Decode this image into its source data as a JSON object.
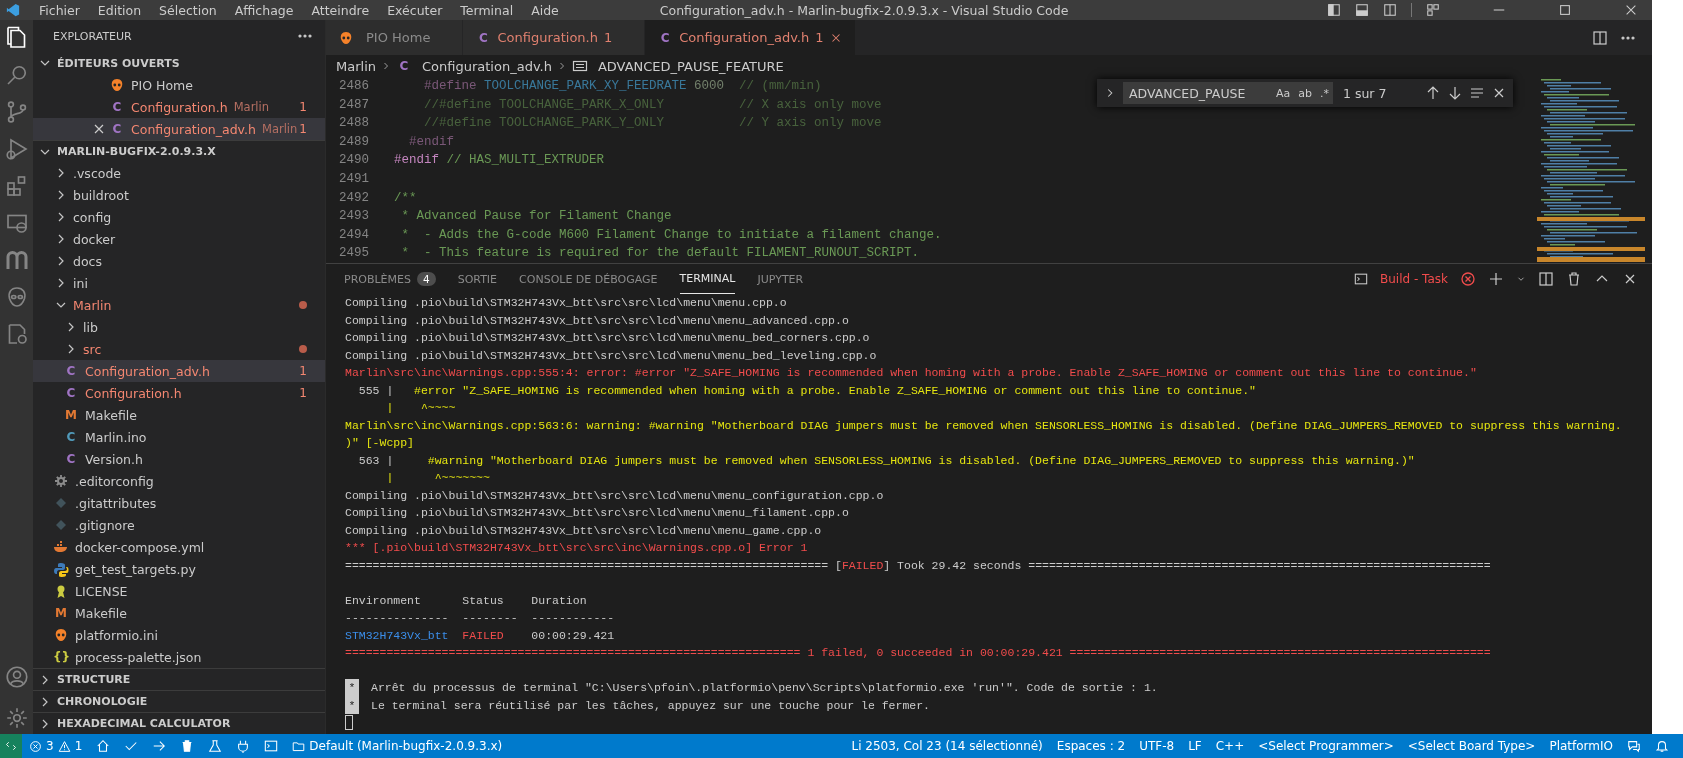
{
  "title_bar": {
    "menu": [
      "Fichier",
      "Edition",
      "Sélection",
      "Affichage",
      "Atteindre",
      "Exécuter",
      "Terminal",
      "Aide"
    ],
    "title": "Configuration_adv.h - Marlin-bugfix-2.0.9.3.x - Visual Studio Code"
  },
  "activity_bar": {
    "items": [
      {
        "kind": "files",
        "selected": true
      },
      {
        "kind": "search",
        "selected": false
      },
      {
        "kind": "source-control",
        "selected": false
      },
      {
        "kind": "run",
        "selected": false
      },
      {
        "kind": "extensions",
        "selected": false
      },
      {
        "kind": "remote",
        "selected": false
      },
      {
        "kind": "arches",
        "selected": false
      },
      {
        "kind": "alien",
        "selected": false
      },
      {
        "kind": "doc-gear",
        "selected": false
      }
    ]
  },
  "sidebar": {
    "title": "EXPLORATEUR",
    "open_editors": {
      "label": "ÉDITEURS OUVERTS",
      "expanded": true,
      "items": [
        {
          "kind": "piofile",
          "name": "PIO Home",
          "error": false,
          "selected": false
        },
        {
          "kind": "cfile",
          "name": "Configuration.h",
          "glyph": "C",
          "folder": "Marlin",
          "count": "1",
          "error": true,
          "selected": false
        },
        {
          "kind": "cfile",
          "name": "Configuration_adv.h",
          "glyph": "C",
          "folder": "Marlin",
          "count": "1",
          "error": true,
          "selected": true
        }
      ]
    },
    "project": {
      "label": "MARLIN-BUGFIX-2.0.9.3.X",
      "expanded": true,
      "children": [
        {
          "kind": "folder",
          "name": ".vscode",
          "expanded": false,
          "error": false,
          "modified": false,
          "selected": false
        },
        {
          "kind": "folder",
          "name": "buildroot",
          "expanded": false,
          "error": false,
          "modified": false,
          "selected": false
        },
        {
          "kind": "folder",
          "name": "config",
          "expanded": false,
          "error": false,
          "modified": false,
          "selected": false
        },
        {
          "kind": "folder",
          "name": "docker",
          "expanded": false,
          "error": false,
          "modified": false,
          "selected": false
        },
        {
          "kind": "folder",
          "name": "docs",
          "expanded": false,
          "error": false,
          "modified": false,
          "selected": false
        },
        {
          "kind": "folder",
          "name": "ini",
          "expanded": false,
          "error": false,
          "modified": false,
          "selected": false
        },
        {
          "kind": "folder",
          "name": "Marlin",
          "expanded": true,
          "error": true,
          "modified": true,
          "selected": false,
          "children": [
            {
              "kind": "folder",
              "name": "lib",
              "expanded": false,
              "error": false,
              "modified": false,
              "selected": false
            },
            {
              "kind": "folder",
              "name": "src",
              "expanded": false,
              "error": true,
              "modified": true,
              "selected": false
            },
            {
              "kind": "cfile",
              "name": "Configuration_adv.h",
              "glyph": "C",
              "count": "1",
              "error": true,
              "selected": true
            },
            {
              "kind": "cfile",
              "name": "Configuration.h",
              "glyph": "C",
              "count": "1",
              "error": true,
              "selected": false
            },
            {
              "kind": "makefile",
              "name": "Makefile",
              "glyph": "M",
              "error": false,
              "selected": false
            },
            {
              "kind": "inofile",
              "name": "Marlin.ino",
              "glyph": "C",
              "error": false,
              "selected": false
            },
            {
              "kind": "cfile",
              "name": "Version.h",
              "glyph": "C",
              "error": false,
              "selected": false
            }
          ]
        },
        {
          "kind": "gearfile",
          "name": ".editorconfig",
          "error": false,
          "selected": false
        },
        {
          "kind": "gitfile",
          "name": ".gitattributes",
          "error": false,
          "selected": false
        },
        {
          "kind": "gitfile",
          "name": ".gitignore",
          "error": false,
          "selected": false
        },
        {
          "kind": "dockerfile",
          "name": "docker-compose.yml",
          "error": false,
          "selected": false
        },
        {
          "kind": "pythonfile",
          "name": "get_test_targets.py",
          "error": false,
          "selected": false
        },
        {
          "kind": "licensefile",
          "name": "LICENSE",
          "error": false,
          "selected": false
        },
        {
          "kind": "makefile",
          "name": "Makefile",
          "glyph": "M",
          "error": false,
          "selected": false
        },
        {
          "kind": "piofile",
          "name": "platformio.ini",
          "error": false,
          "selected": false
        },
        {
          "kind": "jsonfile",
          "name": "process-palette.json",
          "glyph": "{}",
          "error": false,
          "selected": false
        }
      ]
    },
    "sections": [
      {
        "label": "STRUCTURE",
        "expanded": false
      },
      {
        "label": "CHRONOLOGIE",
        "expanded": false
      },
      {
        "label": "HEXADECIMAL CALCULATOR",
        "expanded": false
      }
    ]
  },
  "tabs": [
    {
      "kind": "piofile",
      "label": "PIO Home",
      "error": false,
      "selected": false
    },
    {
      "kind": "cfile",
      "label": "Configuration.h",
      "glyph": "C",
      "count": "1",
      "error": true,
      "selected": false
    },
    {
      "kind": "cfile",
      "label": "Configuration_adv.h",
      "glyph": "C",
      "count": "1",
      "error": true,
      "selected": true
    }
  ],
  "breadcrumb": [
    {
      "kind": "folder",
      "label": "Marlin"
    },
    {
      "kind": "cfile",
      "label": "Configuration_adv.h",
      "glyph": "C"
    },
    {
      "kind": "symbol",
      "label": "ADVANCED_PAUSE_FEATURE"
    }
  ],
  "editor": {
    "lines": [
      {
        "number": "2486",
        "inactive": true,
        "parts": [
          {
            "text": "    #define",
            "kind": "directive"
          },
          {
            "text": " TOOLCHANGE_PARK_XY_FEEDRATE ",
            "kind": "macro"
          },
          {
            "text": "6000",
            "kind": "number"
          },
          {
            "text": "  // (mm/min)",
            "kind": "comment"
          }
        ]
      },
      {
        "number": "2487",
        "inactive": true,
        "parts": [
          {
            "text": "    //#define TOOLCHANGE_PARK_X_ONLY          // X axis only move",
            "kind": "comment"
          }
        ]
      },
      {
        "number": "2488",
        "inactive": true,
        "parts": [
          {
            "text": "    //#define TOOLCHANGE_PARK_Y_ONLY          // Y axis only move",
            "kind": "comment"
          }
        ]
      },
      {
        "number": "2489",
        "inactive": true,
        "parts": [
          {
            "text": "  #endif",
            "kind": "directive"
          }
        ]
      },
      {
        "number": "2490",
        "inactive": false,
        "parts": [
          {
            "text": "#endif",
            "kind": "directive"
          },
          {
            "text": " // HAS_MULTI_EXTRUDER",
            "kind": "comment"
          }
        ]
      },
      {
        "number": "2491"
      },
      {
        "number": "2492",
        "inactive": false,
        "parts": [
          {
            "text": "/**",
            "kind": "comment"
          }
        ]
      },
      {
        "number": "2493",
        "inactive": false,
        "parts": [
          {
            "text": " * Advanced Pause for Filament Change",
            "kind": "comment"
          }
        ]
      },
      {
        "number": "2494",
        "inactive": false,
        "parts": [
          {
            "text": " *  - Adds the G-code M600 Filament Change to initiate a filament change.",
            "kind": "comment"
          }
        ]
      },
      {
        "number": "2495",
        "inactive": false,
        "parts": [
          {
            "text": " *  - This feature is required for the default FILAMENT_RUNOUT_SCRIPT.",
            "kind": "comment"
          }
        ]
      }
    ]
  },
  "find_widget": {
    "value": "ADVANCED_PAUSE",
    "options": [
      "Aa",
      "ab",
      ".*"
    ],
    "result": "1 sur 7"
  },
  "panel": {
    "tabs": [
      {
        "label": "PROBLÈMES",
        "badge": "4",
        "selected": false
      },
      {
        "label": "SORTIE",
        "selected": false
      },
      {
        "label": "CONSOLE DE DÉBOGAGE",
        "selected": false
      },
      {
        "label": "TERMINAL",
        "selected": true
      },
      {
        "label": "JUPYTER",
        "selected": false
      }
    ],
    "task": "Build - Task"
  },
  "terminal": {
    "cursor": true,
    "lines": [
      {
        "kind": "text",
        "parts": [
          {
            "text": "Compiling .pio\\build\\STM32H743Vx_btt\\src\\src\\lcd\\menu\\menu.cpp.o",
            "kind": "plain"
          }
        ]
      },
      {
        "kind": "text",
        "parts": [
          {
            "text": "Compiling .pio\\build\\STM32H743Vx_btt\\src\\src\\lcd\\menu\\menu_advanced.cpp.o",
            "kind": "plain"
          }
        ]
      },
      {
        "kind": "text",
        "parts": [
          {
            "text": "Compiling .pio\\build\\STM32H743Vx_btt\\src\\src\\lcd\\menu\\menu_bed_corners.cpp.o",
            "kind": "plain"
          }
        ]
      },
      {
        "kind": "text",
        "parts": [
          {
            "text": "Compiling .pio\\build\\STM32H743Vx_btt\\src\\src\\lcd\\menu\\menu_bed_leveling.cpp.o",
            "kind": "plain"
          }
        ]
      },
      {
        "kind": "text",
        "parts": [
          {
            "text": "Marlin\\src\\inc\\Warnings.cpp:555:4: error: #error \"Z_SAFE_HOMING is recommended when homing with a probe. Enable Z_SAFE_HOMING or comment out this line to continue.\"",
            "kind": "error"
          }
        ]
      },
      {
        "kind": "text",
        "parts": [
          {
            "text": "  555 |",
            "kind": "plain"
          },
          {
            "text": "   #error \"Z_SAFE_HOMING is recommended when homing with a probe. Enable Z_SAFE_HOMING or comment out this line to continue.\"",
            "kind": "warning"
          }
        ]
      },
      {
        "kind": "text",
        "parts": [
          {
            "text": "      |    ^~~~~",
            "kind": "warning"
          }
        ]
      },
      {
        "kind": "text",
        "parts": [
          {
            "text": "Marlin\\src\\inc\\Warnings.cpp:563:6: warning: #warning \"Motherboard DIAG jumpers must be removed when SENSORLESS_HOMING is disabled. (Define DIAG_JUMPERS_REMOVED to suppress this warning.",
            "kind": "warning"
          }
        ]
      },
      {
        "kind": "text",
        "parts": [
          {
            "text": ")\" [-Wcpp]",
            "kind": "warning"
          }
        ]
      },
      {
        "kind": "text",
        "parts": [
          {
            "text": "  563 |",
            "kind": "plain"
          },
          {
            "text": "     #warning \"Motherboard DIAG jumpers must be removed when SENSORLESS_HOMING is disabled. (Define DIAG_JUMPERS_REMOVED to suppress this warning.)\"",
            "kind": "warning"
          }
        ]
      },
      {
        "kind": "text",
        "parts": [
          {
            "text": "      |      ^~~~~~~~",
            "kind": "warning"
          }
        ]
      },
      {
        "kind": "text",
        "parts": [
          {
            "text": "Compiling .pio\\build\\STM32H743Vx_btt\\src\\src\\lcd\\menu\\menu_configuration.cpp.o",
            "kind": "plain"
          }
        ]
      },
      {
        "kind": "text",
        "parts": [
          {
            "text": "Compiling .pio\\build\\STM32H743Vx_btt\\src\\src\\lcd\\menu\\menu_filament.cpp.o",
            "kind": "plain"
          }
        ]
      },
      {
        "kind": "text",
        "parts": [
          {
            "text": "Compiling .pio\\build\\STM32H743Vx_btt\\src\\src\\lcd\\menu\\menu_game.cpp.o",
            "kind": "plain"
          }
        ]
      },
      {
        "kind": "text",
        "parts": [
          {
            "text": "*** [.pio\\build\\STM32H743Vx_btt\\src\\src\\inc\\Warnings.cpp.o] Error 1",
            "kind": "error"
          }
        ]
      },
      {
        "kind": "text",
        "parts": [
          {
            "text": "====================================================================== [",
            "kind": "plain"
          },
          {
            "text": "FAILED",
            "kind": "error"
          },
          {
            "text": "] Took 29.42 seconds ===================================================================",
            "kind": "plain"
          }
        ]
      },
      {
        "kind": "blank"
      },
      {
        "kind": "text",
        "parts": [
          {
            "text": "Environment      Status    Duration",
            "kind": "plain"
          }
        ]
      },
      {
        "kind": "text",
        "parts": [
          {
            "text": "---------------  --------  ------------",
            "kind": "plain"
          }
        ]
      },
      {
        "kind": "text",
        "parts": [
          {
            "text": "STM32H743Vx_btt",
            "kind": "env"
          },
          {
            "text": "  FAILED",
            "kind": "error"
          },
          {
            "text": "    00:00:29.421",
            "kind": "plain"
          }
        ]
      },
      {
        "kind": "text",
        "parts": [
          {
            "text": "================================================================== 1 failed, 0 succeeded in 00:00:29.421 =============================================================",
            "kind": "error"
          }
        ]
      },
      {
        "kind": "blank"
      },
      {
        "kind": "notice",
        "marker": "*",
        "text": "Arrêt du processus de terminal \"C:\\Users\\pfoin\\.platformio\\penv\\Scripts\\platformio.exe 'run'\". Code de sortie : 1."
      },
      {
        "kind": "notice",
        "marker": "*",
        "text": "Le terminal sera réutilisé par les tâches, appuyez sur une touche pour le fermer."
      }
    ]
  },
  "status_bar": {
    "errors": "3",
    "warnings": "1",
    "env": "Default (Marlin-bugfix-2.0.9.3.x)",
    "right": [
      "Li 2503, Col 23 (14 sélectionné)",
      "Espaces : 2",
      "UTF-8",
      "LF",
      "C++",
      "<Select Programmer>",
      "<Select Board Type>",
      "PlatformIO"
    ]
  }
}
